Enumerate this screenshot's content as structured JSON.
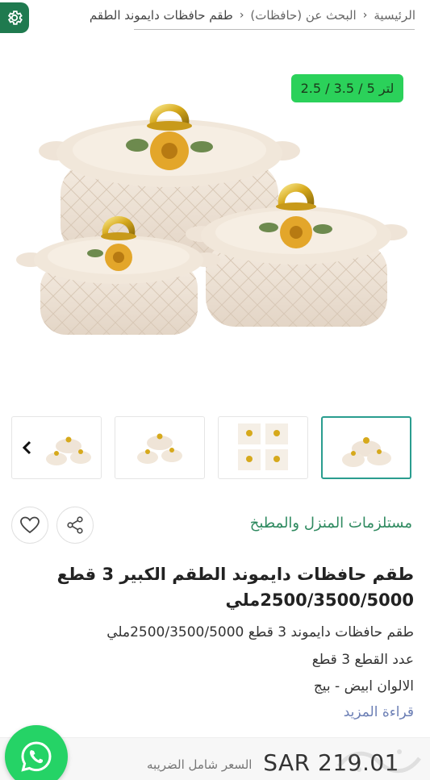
{
  "breadcrumb": {
    "home": "الرئيسية",
    "search": "البحث عن (حافظات)",
    "current": "طقم حافظات دايموند الطقم"
  },
  "hero": {
    "size_badge": "2.5 / 3.5 / 5 لتر"
  },
  "thumbnails": {
    "count_visible": 4,
    "active_index": 0
  },
  "product": {
    "category": "مستلزمات المنزل والمطبخ",
    "title_line1": "طقم حافظات دايموند الطقم الكبير 3 قطع",
    "title_line2": "2500/3500/5000ملي",
    "desc_line1": "طقم حافظات دايموند 3 قطع 2500/3500/5000ملي",
    "desc_line2": "عدد القطع 3 قطع",
    "desc_line3": "الالوان ابيض - بيج",
    "read_more": "قراءة المزيد"
  },
  "price": {
    "amount": "SAR 219.01",
    "tax_note": "السعر شامل الضريبه"
  },
  "icons": {
    "settings": "gear-icon",
    "favorite": "heart-icon",
    "share": "share-icon",
    "prev": "chevron-left-icon",
    "chat": "whatsapp-icon"
  },
  "colors": {
    "accent_green": "#1f7a4f",
    "badge_green": "#2bd15a",
    "category_green": "#2f8a60",
    "active_thumb_border": "#2a9d8f",
    "read_more_blue": "#6c7fb5",
    "whatsapp": "#25d366"
  }
}
